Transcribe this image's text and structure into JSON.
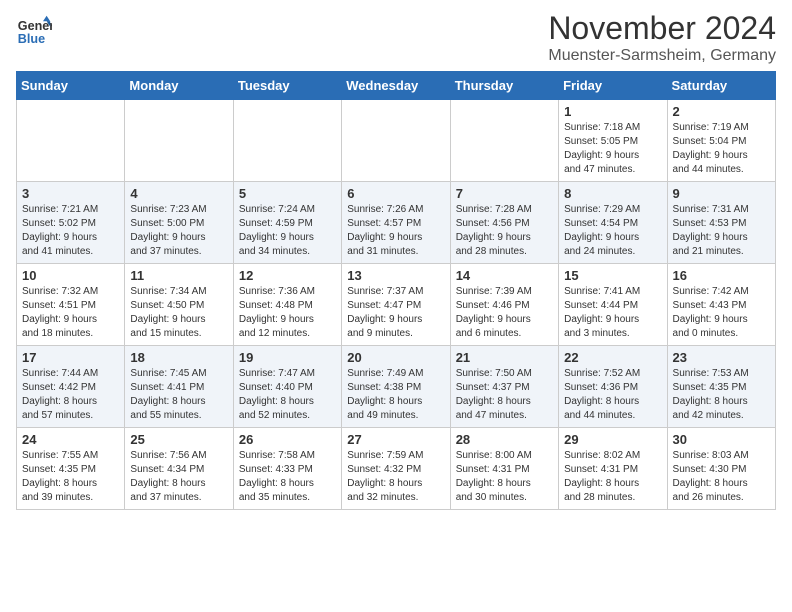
{
  "logo": {
    "line1": "General",
    "line2": "Blue"
  },
  "header": {
    "month": "November 2024",
    "location": "Muenster-Sarmsheim, Germany"
  },
  "weekdays": [
    "Sunday",
    "Monday",
    "Tuesday",
    "Wednesday",
    "Thursday",
    "Friday",
    "Saturday"
  ],
  "weeks": [
    [
      {
        "day": "",
        "info": ""
      },
      {
        "day": "",
        "info": ""
      },
      {
        "day": "",
        "info": ""
      },
      {
        "day": "",
        "info": ""
      },
      {
        "day": "",
        "info": ""
      },
      {
        "day": "1",
        "info": "Sunrise: 7:18 AM\nSunset: 5:05 PM\nDaylight: 9 hours\nand 47 minutes."
      },
      {
        "day": "2",
        "info": "Sunrise: 7:19 AM\nSunset: 5:04 PM\nDaylight: 9 hours\nand 44 minutes."
      }
    ],
    [
      {
        "day": "3",
        "info": "Sunrise: 7:21 AM\nSunset: 5:02 PM\nDaylight: 9 hours\nand 41 minutes."
      },
      {
        "day": "4",
        "info": "Sunrise: 7:23 AM\nSunset: 5:00 PM\nDaylight: 9 hours\nand 37 minutes."
      },
      {
        "day": "5",
        "info": "Sunrise: 7:24 AM\nSunset: 4:59 PM\nDaylight: 9 hours\nand 34 minutes."
      },
      {
        "day": "6",
        "info": "Sunrise: 7:26 AM\nSunset: 4:57 PM\nDaylight: 9 hours\nand 31 minutes."
      },
      {
        "day": "7",
        "info": "Sunrise: 7:28 AM\nSunset: 4:56 PM\nDaylight: 9 hours\nand 28 minutes."
      },
      {
        "day": "8",
        "info": "Sunrise: 7:29 AM\nSunset: 4:54 PM\nDaylight: 9 hours\nand 24 minutes."
      },
      {
        "day": "9",
        "info": "Sunrise: 7:31 AM\nSunset: 4:53 PM\nDaylight: 9 hours\nand 21 minutes."
      }
    ],
    [
      {
        "day": "10",
        "info": "Sunrise: 7:32 AM\nSunset: 4:51 PM\nDaylight: 9 hours\nand 18 minutes."
      },
      {
        "day": "11",
        "info": "Sunrise: 7:34 AM\nSunset: 4:50 PM\nDaylight: 9 hours\nand 15 minutes."
      },
      {
        "day": "12",
        "info": "Sunrise: 7:36 AM\nSunset: 4:48 PM\nDaylight: 9 hours\nand 12 minutes."
      },
      {
        "day": "13",
        "info": "Sunrise: 7:37 AM\nSunset: 4:47 PM\nDaylight: 9 hours\nand 9 minutes."
      },
      {
        "day": "14",
        "info": "Sunrise: 7:39 AM\nSunset: 4:46 PM\nDaylight: 9 hours\nand 6 minutes."
      },
      {
        "day": "15",
        "info": "Sunrise: 7:41 AM\nSunset: 4:44 PM\nDaylight: 9 hours\nand 3 minutes."
      },
      {
        "day": "16",
        "info": "Sunrise: 7:42 AM\nSunset: 4:43 PM\nDaylight: 9 hours\nand 0 minutes."
      }
    ],
    [
      {
        "day": "17",
        "info": "Sunrise: 7:44 AM\nSunset: 4:42 PM\nDaylight: 8 hours\nand 57 minutes."
      },
      {
        "day": "18",
        "info": "Sunrise: 7:45 AM\nSunset: 4:41 PM\nDaylight: 8 hours\nand 55 minutes."
      },
      {
        "day": "19",
        "info": "Sunrise: 7:47 AM\nSunset: 4:40 PM\nDaylight: 8 hours\nand 52 minutes."
      },
      {
        "day": "20",
        "info": "Sunrise: 7:49 AM\nSunset: 4:38 PM\nDaylight: 8 hours\nand 49 minutes."
      },
      {
        "day": "21",
        "info": "Sunrise: 7:50 AM\nSunset: 4:37 PM\nDaylight: 8 hours\nand 47 minutes."
      },
      {
        "day": "22",
        "info": "Sunrise: 7:52 AM\nSunset: 4:36 PM\nDaylight: 8 hours\nand 44 minutes."
      },
      {
        "day": "23",
        "info": "Sunrise: 7:53 AM\nSunset: 4:35 PM\nDaylight: 8 hours\nand 42 minutes."
      }
    ],
    [
      {
        "day": "24",
        "info": "Sunrise: 7:55 AM\nSunset: 4:35 PM\nDaylight: 8 hours\nand 39 minutes."
      },
      {
        "day": "25",
        "info": "Sunrise: 7:56 AM\nSunset: 4:34 PM\nDaylight: 8 hours\nand 37 minutes."
      },
      {
        "day": "26",
        "info": "Sunrise: 7:58 AM\nSunset: 4:33 PM\nDaylight: 8 hours\nand 35 minutes."
      },
      {
        "day": "27",
        "info": "Sunrise: 7:59 AM\nSunset: 4:32 PM\nDaylight: 8 hours\nand 32 minutes."
      },
      {
        "day": "28",
        "info": "Sunrise: 8:00 AM\nSunset: 4:31 PM\nDaylight: 8 hours\nand 30 minutes."
      },
      {
        "day": "29",
        "info": "Sunrise: 8:02 AM\nSunset: 4:31 PM\nDaylight: 8 hours\nand 28 minutes."
      },
      {
        "day": "30",
        "info": "Sunrise: 8:03 AM\nSunset: 4:30 PM\nDaylight: 8 hours\nand 26 minutes."
      }
    ]
  ]
}
